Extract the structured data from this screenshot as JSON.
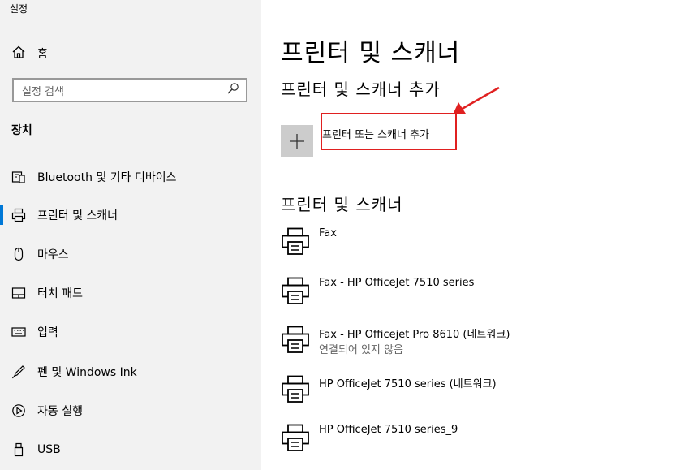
{
  "app_title": "설정",
  "sidebar": {
    "home_label": "홈",
    "search_placeholder": "설정 검색",
    "section_label": "장치",
    "items": [
      {
        "label": "Bluetooth 및 기타 디바이스",
        "icon": "bluetooth-devices-icon"
      },
      {
        "label": "프린터 및 스캐너",
        "icon": "printer-icon",
        "selected": true
      },
      {
        "label": "마우스",
        "icon": "mouse-icon"
      },
      {
        "label": "터치 패드",
        "icon": "touchpad-icon"
      },
      {
        "label": "입력",
        "icon": "keyboard-icon"
      },
      {
        "label": "펜 및 Windows Ink",
        "icon": "pen-icon"
      },
      {
        "label": "자동 실행",
        "icon": "autoplay-icon"
      },
      {
        "label": "USB",
        "icon": "usb-icon"
      }
    ]
  },
  "main": {
    "title": "프린터 및 스캐너",
    "add_section_title": "프린터 및 스캐너 추가",
    "add_button_label": "프린터 또는 스캐너 추가",
    "list_heading": "프린터 및 스캐너",
    "printers": [
      {
        "name": "Fax",
        "status": ""
      },
      {
        "name": "Fax - HP OfficeJet 7510 series",
        "status": ""
      },
      {
        "name": "Fax - HP Officejet Pro 8610 (네트워크)",
        "status": "연결되어 있지 않음"
      },
      {
        "name": "HP OfficeJet 7510 series (네트워크)",
        "status": ""
      },
      {
        "name": "HP OfficeJet 7510 series_9",
        "status": ""
      }
    ]
  },
  "colors": {
    "sidebar_bg": "#f2f2f2",
    "accent": "#0078d7",
    "highlight": "#e02020",
    "tile_bg": "#cccccc"
  }
}
